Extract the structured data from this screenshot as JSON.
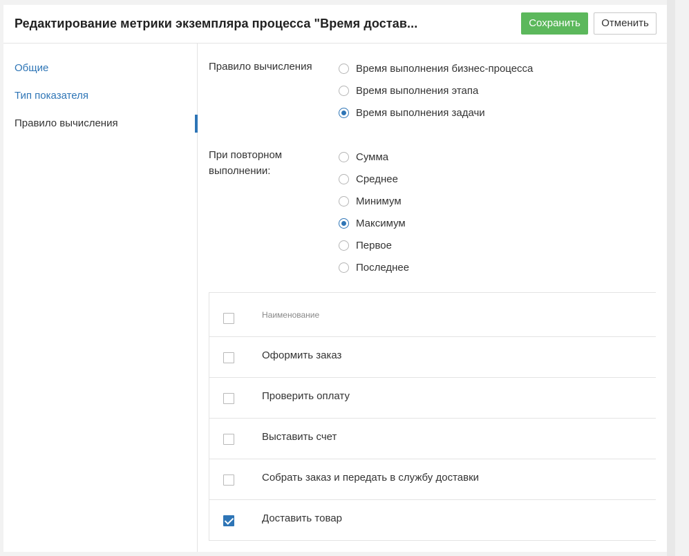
{
  "header": {
    "title": "Редактирование метрики экземпляра процесса \"Время достав...",
    "save_label": "Сохранить",
    "cancel_label": "Отменить"
  },
  "colors": {
    "accent": "#2e75b6",
    "save_button": "#5cb85c"
  },
  "sidebar": {
    "items": [
      {
        "label": "Общие",
        "active": false
      },
      {
        "label": "Тип показателя",
        "active": false
      },
      {
        "label": "Правило вычисления",
        "active": true
      }
    ]
  },
  "calc_rule": {
    "label": "Правило вычисления",
    "options": [
      {
        "label": "Время выполнения бизнес-процесса",
        "checked": false
      },
      {
        "label": "Время выполнения этапа",
        "checked": false
      },
      {
        "label": "Время выполнения задачи",
        "checked": true
      }
    ]
  },
  "repeat": {
    "label_line1": "При повторном",
    "label_line2": "выполнении:",
    "options": [
      {
        "label": "Сумма",
        "checked": false
      },
      {
        "label": "Среднее",
        "checked": false
      },
      {
        "label": "Минимум",
        "checked": false
      },
      {
        "label": "Максимум",
        "checked": true
      },
      {
        "label": "Первое",
        "checked": false
      },
      {
        "label": "Последнее",
        "checked": false
      }
    ]
  },
  "table": {
    "header": "Наименование",
    "rows": [
      {
        "name": "Оформить заказ",
        "checked": false
      },
      {
        "name": "Проверить оплату",
        "checked": false
      },
      {
        "name": "Выставить счет",
        "checked": false
      },
      {
        "name": "Собрать заказ и передать в службу доставки",
        "checked": false
      },
      {
        "name": "Доставить товар",
        "checked": true
      }
    ]
  }
}
